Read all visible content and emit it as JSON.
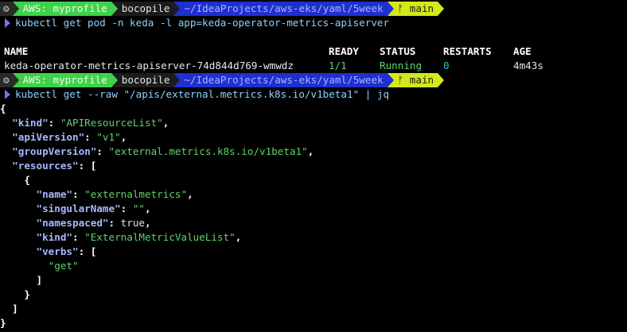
{
  "prompt": {
    "apple": "⚙",
    "aws": "AWS: myprofile",
    "user": "bocopile",
    "path": "~/IdeaProjects/aws-eks/yaml/5week",
    "git_icon": "ᚠ",
    "branch": "main"
  },
  "commands": {
    "first": "kubectl get pod -n keda -l app=keda-operator-metrics-apiserver",
    "second": "kubectl get --raw \"/apis/external.metrics.k8s.io/v1beta1\" | jq"
  },
  "pod_table": {
    "headers": {
      "name": "NAME",
      "ready": "READY",
      "status": "STATUS",
      "restarts": "RESTARTS",
      "age": "AGE"
    },
    "row": {
      "name": "keda-operator-metrics-apiserver-74d844d769-wmwdz",
      "ready": "1/1",
      "status": "Running",
      "restarts": "0",
      "age": "4m43s"
    }
  },
  "json_output": {
    "open_brace": "{",
    "kind_key": "\"kind\"",
    "kind_val": "\"APIResourceList\"",
    "apiVersion_key": "\"apiVersion\"",
    "apiVersion_val": "\"v1\"",
    "groupVersion_key": "\"groupVersion\"",
    "groupVersion_val": "\"external.metrics.k8s.io/v1beta1\"",
    "resources_key": "\"resources\"",
    "name_key": "\"name\"",
    "name_val": "\"externalmetrics\"",
    "singularName_key": "\"singularName\"",
    "singularName_val": "\"\"",
    "namespaced_key": "\"namespaced\"",
    "namespaced_val": "true",
    "res_kind_key": "\"kind\"",
    "res_kind_val": "\"ExternalMetricValueList\"",
    "verbs_key": "\"verbs\"",
    "verb_0": "\"get\""
  },
  "colors": {
    "aws_segment": "#3fd14a",
    "path_segment": "#1f2fd0",
    "git_segment": "#d4e81a",
    "json_key": "#a6b8ff",
    "json_string": "#5fd36b"
  }
}
